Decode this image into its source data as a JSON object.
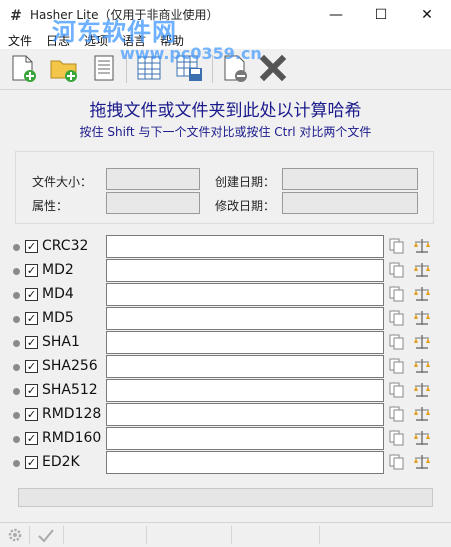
{
  "window": {
    "title": "Hasher Lite（仅用于非商业使用）",
    "app_icon_glyph": "#",
    "minimize_glyph": "—",
    "maximize_glyph": "☐",
    "close_glyph": "✕"
  },
  "watermark": {
    "text": "河东软件网",
    "url": "www.pc0359.cn"
  },
  "menu": {
    "items": [
      {
        "label": "文件"
      },
      {
        "label": "日志"
      },
      {
        "label": "选项"
      },
      {
        "label": "语言"
      },
      {
        "label": "帮助"
      }
    ]
  },
  "toolbar": {
    "icons": [
      "add-file-icon",
      "add-folder-icon",
      "document-icon",
      "table-icon",
      "save-table-icon",
      "remove-file-icon",
      "clear-icon"
    ]
  },
  "main": {
    "heading": "拖拽文件或文件夹到此处以计算哈希",
    "subheading": "按住 Shift 与下一个文件对比或按住 Ctrl 对比两个文件"
  },
  "info": {
    "file_size_label": "文件大小：",
    "attributes_label": "属性：",
    "created_label": "创建日期：",
    "modified_label": "修改日期：",
    "file_size_value": "",
    "attributes_value": "",
    "created_value": "",
    "modified_value": ""
  },
  "hashes": [
    {
      "name": "CRC32",
      "checked": true,
      "value": "",
      "check_glyph": "✓"
    },
    {
      "name": "MD2",
      "checked": true,
      "value": "",
      "check_glyph": "✓"
    },
    {
      "name": "MD4",
      "checked": true,
      "value": "",
      "check_glyph": "✓"
    },
    {
      "name": "MD5",
      "checked": true,
      "value": "",
      "check_glyph": "✓"
    },
    {
      "name": "SHA1",
      "checked": true,
      "value": "",
      "check_glyph": "✓"
    },
    {
      "name": "SHA256",
      "checked": true,
      "value": "",
      "check_glyph": "✓"
    },
    {
      "name": "SHA512",
      "checked": true,
      "value": "",
      "check_glyph": "✓"
    },
    {
      "name": "RMD128",
      "checked": true,
      "value": "",
      "check_glyph": "✓"
    },
    {
      "name": "RMD160",
      "checked": true,
      "value": "",
      "check_glyph": "✓"
    },
    {
      "name": "ED2K",
      "checked": true,
      "value": "",
      "check_glyph": "✓"
    }
  ],
  "progress": {
    "value": 0
  },
  "statusbar": {
    "icons": [
      "gear-icon",
      "checkmark-icon"
    ]
  },
  "colors": {
    "heading": "#1a1a8c",
    "watermark": "#3c96ff"
  }
}
